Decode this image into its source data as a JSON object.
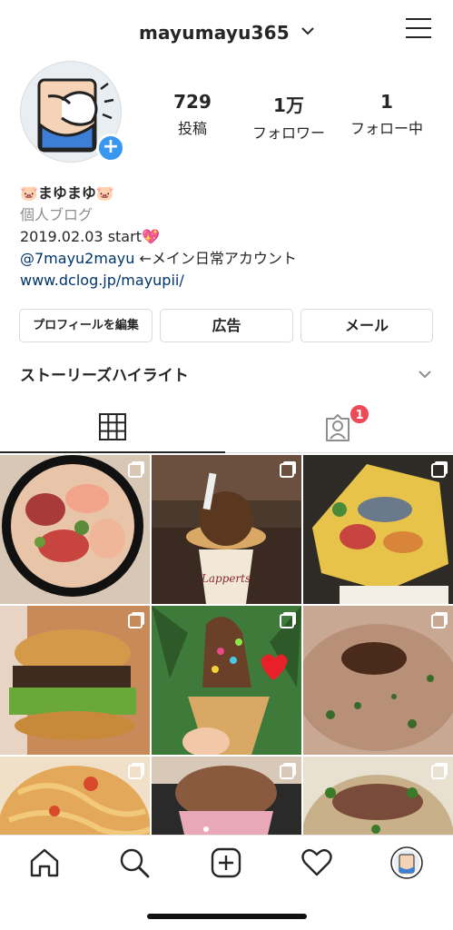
{
  "header": {
    "username": "mayumayu365"
  },
  "profile": {
    "stats": [
      {
        "value": "729",
        "label": "投稿"
      },
      {
        "value": "1万",
        "label": "フォロワー"
      },
      {
        "value": "1",
        "label": "フォロー中"
      }
    ],
    "bio": {
      "name": "🐷まゆまゆ🐷",
      "category": "個人ブログ",
      "line1": "2019.02.03 start💖",
      "mention": "@7mayu2mayu",
      "mention_suffix": " ←メイン日常アカウント",
      "website": "www.dclog.jp/mayupii/"
    }
  },
  "buttons": {
    "edit_profile": "プロフィールを編集",
    "ads": "広告",
    "email": "メール"
  },
  "highlights": {
    "label": "ストーリーズハイライト"
  },
  "tabs": {
    "tagged_badge": "1"
  },
  "posts": [
    {
      "icon": "multi-photo-icon",
      "alt": "poke bowl"
    },
    {
      "icon": "multi-photo-icon",
      "alt": "ice cream"
    },
    {
      "icon": "multi-photo-icon",
      "alt": "chirashi"
    },
    {
      "icon": "multi-photo-icon",
      "alt": "burger"
    },
    {
      "icon": "multi-photo-icon",
      "alt": "soft serve"
    },
    {
      "icon": "multi-photo-icon",
      "alt": "risotto"
    },
    {
      "icon": "multi-photo-icon",
      "alt": "pasta"
    },
    {
      "icon": "multi-photo-icon",
      "alt": "chocolate cone"
    },
    {
      "icon": "multi-photo-icon",
      "alt": "soup"
    }
  ],
  "colors": {
    "accent": "#3897f0",
    "link": "#003569",
    "badge": "#ed4956",
    "text": "#262626",
    "muted": "#8e8e8e"
  }
}
